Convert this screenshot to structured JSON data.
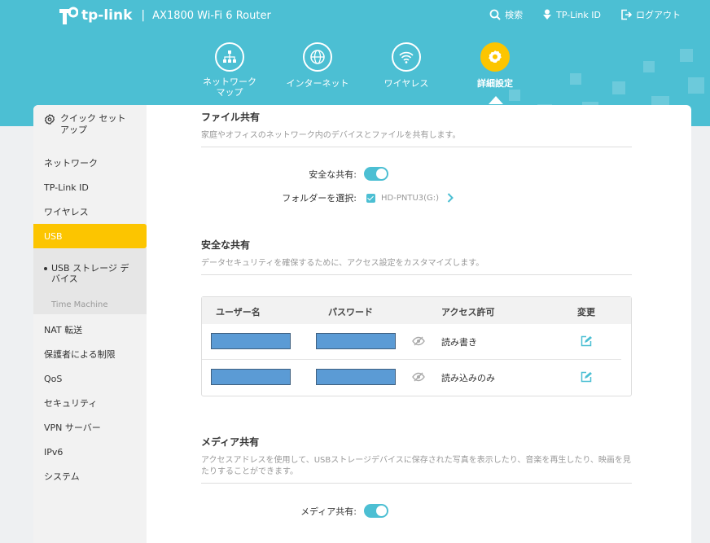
{
  "header": {
    "brand": "tp-link",
    "separator": "|",
    "model": "AX1800 Wi-Fi 6 Router",
    "actions": [
      {
        "label": "検索",
        "icon": "search-icon"
      },
      {
        "label": "TP-Link ID",
        "icon": "tplink-id-icon"
      },
      {
        "label": "ログアウト",
        "icon": "logout-icon"
      }
    ],
    "colors": {
      "header_bg": "#4cbfd3",
      "accent": "#fcc500"
    }
  },
  "nav": [
    {
      "label": "ネットワーク\nマップ",
      "icon": "network-map-icon",
      "active": false
    },
    {
      "label": "インターネット",
      "icon": "globe-icon",
      "active": false
    },
    {
      "label": "ワイヤレス",
      "icon": "wifi-icon",
      "active": false
    },
    {
      "label": "詳細設定",
      "icon": "gear-icon",
      "active": true
    }
  ],
  "sidebar": {
    "quick_setup": "クイック セット\nアップ",
    "items": [
      "ネットワーク",
      "TP-Link ID",
      "ワイヤレス",
      "USB"
    ],
    "sub_items": [
      "USB ストレージ デ\nバイス",
      "Time Machine"
    ],
    "items_after": [
      "NAT 転送",
      "保護者による制限",
      "QoS",
      "セキュリティ",
      "VPN サーバー",
      "IPv6",
      "システム"
    ]
  },
  "file_sharing": {
    "title": "ファイル共有",
    "desc": "家庭やオフィスのネットワーク内のデバイスとファイルを共有します。",
    "secure_label": "安全な共有:",
    "secure_on": true,
    "folder_label": "フォルダーを選択:",
    "folder_value": "HD-PNTU3(G:)"
  },
  "secure_sharing": {
    "title": "安全な共有",
    "desc": "データセキュリティを確保するために、アクセス設定をカスタマイズします。",
    "columns": [
      "ユーザー名",
      "パスワード",
      "アクセス許可",
      "変更"
    ],
    "rows": [
      {
        "permission": "読み書き"
      },
      {
        "permission": "読み込みのみ"
      }
    ]
  },
  "media_sharing": {
    "title": "メディア共有",
    "desc": "アクセスアドレスを使用して、USBストレージデバイスに保存された写真を表示したり、音楽を再生したり、映画を見たりすることができます。",
    "toggle_label": "メディア共有:",
    "toggle_on": true
  }
}
